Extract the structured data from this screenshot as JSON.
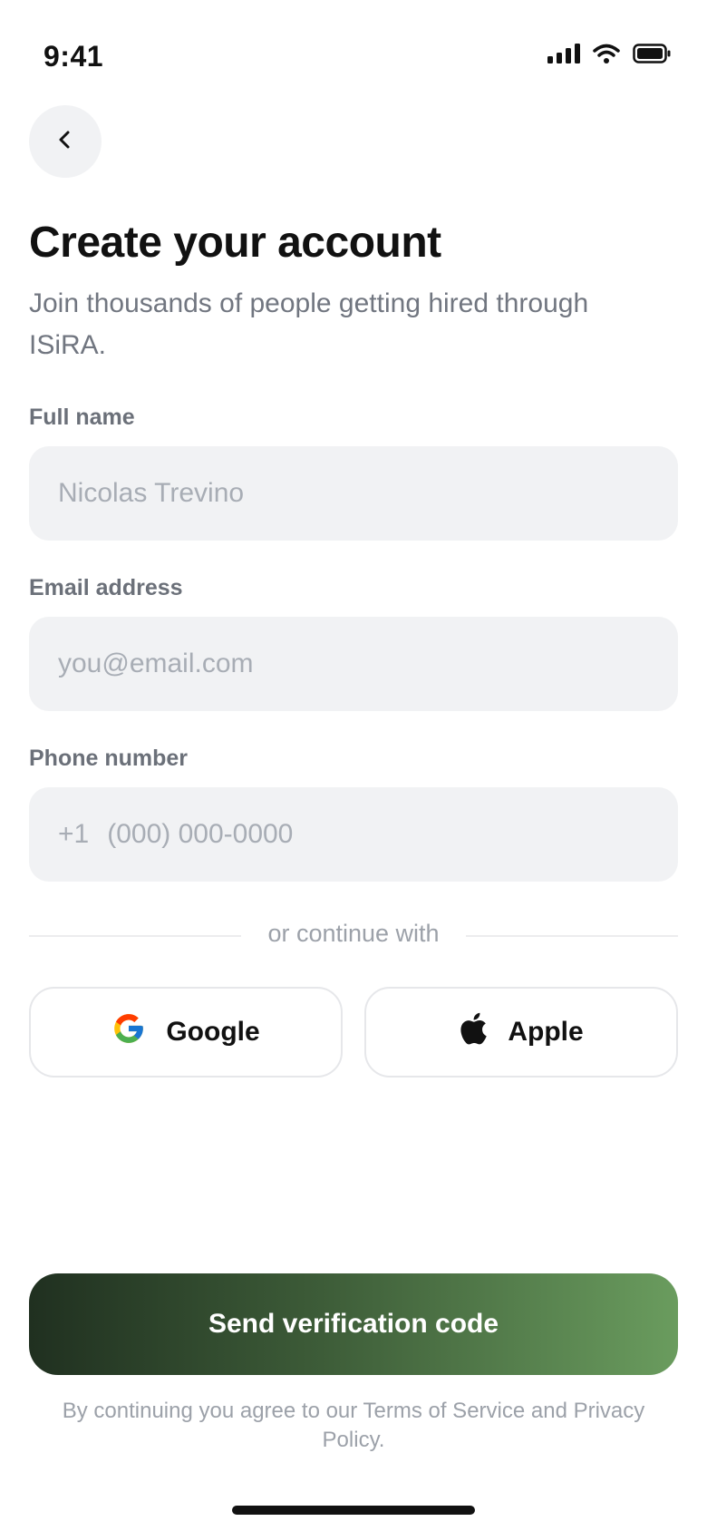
{
  "status_bar": {
    "time": "9:41"
  },
  "header": {
    "title": "Create your account",
    "subtitle": "Join thousands of people getting hired through ISiRA."
  },
  "form": {
    "full_name": {
      "label": "Full name",
      "placeholder": "Nicolas Trevino"
    },
    "email": {
      "label": "Email address",
      "placeholder": "you@email.com"
    },
    "phone": {
      "label": "Phone number",
      "country_code": "+1",
      "placeholder": "(000) 000-0000"
    }
  },
  "divider": {
    "text": "or continue with"
  },
  "social": {
    "google_label": "Google",
    "apple_label": "Apple"
  },
  "primary_action": {
    "label": "Send verification code"
  },
  "legal": {
    "text": "By continuing you agree to our Terms of Service and Privacy Policy."
  },
  "colors": {
    "field_bg": "#f1f2f4",
    "button_gradient_start": "#203020",
    "button_gradient_end": "#6a9c5e"
  },
  "icons": [
    "back-chevron-icon",
    "signal-icon",
    "wifi-icon",
    "battery-icon",
    "google-icon",
    "apple-icon"
  ]
}
